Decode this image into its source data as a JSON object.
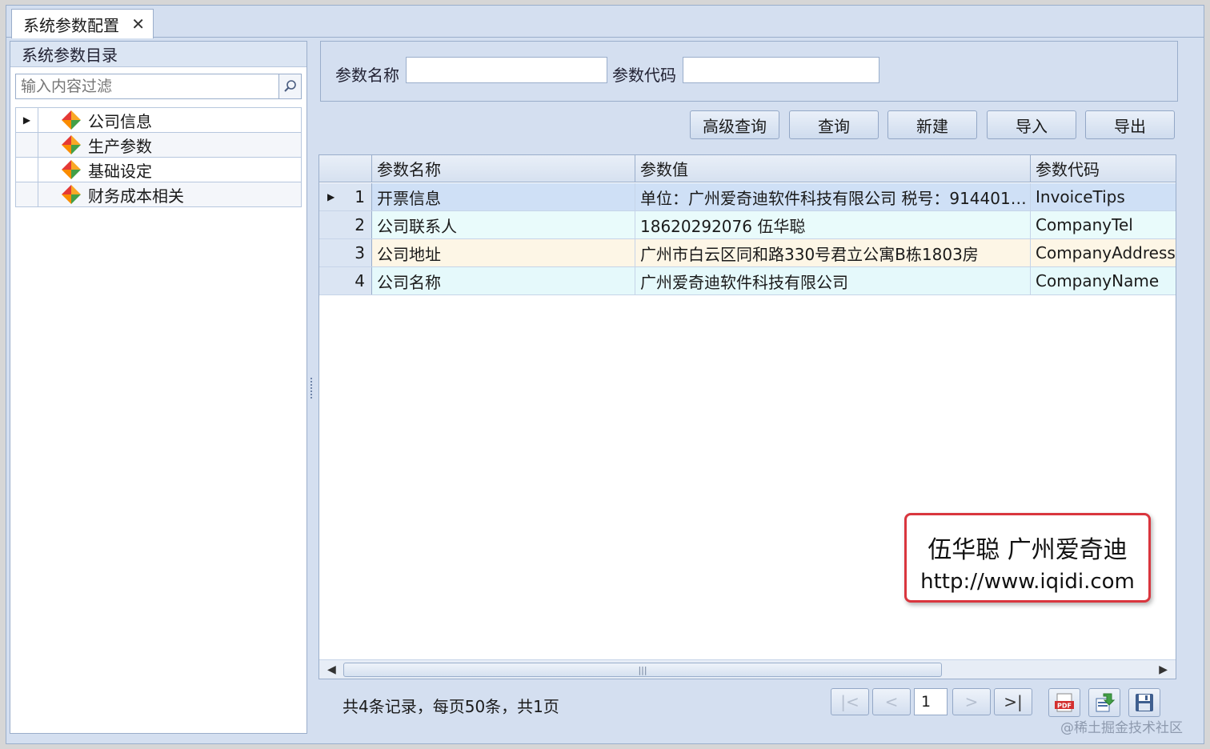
{
  "tab": {
    "title": "系统参数配置",
    "close": "✕"
  },
  "left": {
    "header": "系统参数目录",
    "filter_placeholder": "输入内容过滤",
    "items": [
      {
        "label": "公司信息"
      },
      {
        "label": "生产参数"
      },
      {
        "label": "基础设定"
      },
      {
        "label": "财务成本相关"
      }
    ]
  },
  "search": {
    "name_label": "参数名称",
    "name_value": "",
    "code_label": "参数代码",
    "code_value": ""
  },
  "toolbar": {
    "advanced": "高级查询",
    "query": "查询",
    "new": "新建",
    "import": "导入",
    "export": "导出"
  },
  "grid": {
    "columns": [
      "参数名称",
      "参数值",
      "参数代码"
    ],
    "rows": [
      {
        "no": "1",
        "name": "开票信息",
        "value": "单位：广州爱奇迪软件科技有限公司 税号：914401…",
        "code": "InvoiceTips"
      },
      {
        "no": "2",
        "name": "公司联系人",
        "value": "18620292076 伍华聪",
        "code": "CompanyTel"
      },
      {
        "no": "3",
        "name": "公司地址",
        "value": "广州市白云区同和路330号君立公寓B栋1803房",
        "code": "CompanyAddress"
      },
      {
        "no": "4",
        "name": "公司名称",
        "value": "广州爱奇迪软件科技有限公司",
        "code": "CompanyName"
      }
    ]
  },
  "pager": {
    "summary": "共4条记录，每页50条，共1页",
    "first": "|<",
    "prev": "<",
    "page": "1",
    "next": ">",
    "last": ">|"
  },
  "callout": {
    "line1": "伍华聪 广州爱奇迪",
    "line2": "http://www.iqidi.com"
  },
  "credit": "@稀土掘金技术社区",
  "icons": {
    "pdf": "PDF"
  }
}
